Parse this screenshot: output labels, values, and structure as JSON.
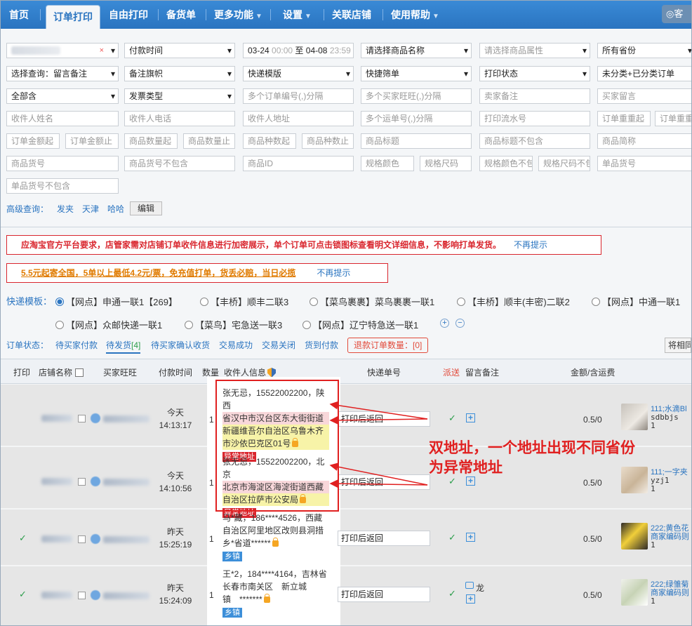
{
  "nav": {
    "items": [
      "首页",
      "订单打印",
      "自由打印",
      "备货单",
      "更多功能",
      "设置",
      "关联店铺",
      "使用帮助"
    ],
    "right": "客"
  },
  "filters": {
    "pay_time": "付款时间",
    "date_start": "03-24",
    "time_start": "00:00",
    "date_sep": "至",
    "date_end": "04-08",
    "time_end": "23:59",
    "product_name": "请选择商品名称",
    "product_attr": "请选择商品属性",
    "province": "所有省份",
    "query": "选择查询：留言备注",
    "memo_flag": "备注旗帜",
    "express_tpl": "快递模版",
    "quick_filter": "快捷筛单",
    "print_status": "打印状态",
    "category": "未分类+已分类订单",
    "all": "全部含",
    "invoice": "发票类型",
    "order_nos": "多个订单编号(,)分隔",
    "buyer_ww": "多个买家旺旺(,)分隔",
    "seller_memo": "卖家备注",
    "buyer_msg": "买家留言",
    "recv_name": "收件人姓名",
    "recv_phone": "收件人电话",
    "recv_addr": "收件人地址",
    "waybill_nos": "多个运单号(,)分隔",
    "print_serial": "打印流水号",
    "weight_from": "订单重重起",
    "weight_to": "订单重重",
    "amt_from": "订单金额起",
    "amt_to": "订单金额止",
    "qty_from": "商品数量起",
    "qty_to": "商品数量止",
    "kind_from": "商品种数起",
    "kind_to": "商品种数止",
    "title": "商品标题",
    "title_ex": "商品标题不包含",
    "short_name": "商品简称",
    "sku_no": "商品货号",
    "sku_no_ex": "商品货号不包含",
    "product_id": "商品ID",
    "spec_color": "规格颜色",
    "spec_size": "规格尺码",
    "spec_color_ex": "规格颜色不包",
    "spec_size_ex": "规格尺码不包",
    "single_no": "单品货号",
    "single_no_ex": "单品货号不包含",
    "adv_label": "高级查询：",
    "adv_links": [
      "发夹",
      "天津",
      "哈哈"
    ],
    "edit": "编辑"
  },
  "notices": {
    "n1": "应淘宝官方平台要求，店管家需对店铺订单收件信息进行加密展示，单个订单可点击锁图标查看明文详细信息，不影响打单发货。",
    "n1_link": "不再提示",
    "n2": "5.5元起寄全国，5单以上最低4.2元/票，免充值打单，货丢必赔，当日必揽",
    "n2_link": "不再提示"
  },
  "express": {
    "label": "快递模板：",
    "options": [
      "【网点】申通一联1【269】",
      "【丰桥】顺丰二联3",
      "【菜鸟裹裹】菜鸟裹裹一联1",
      "【丰桥】顺丰(丰密)二联2",
      "【网点】中通一联1",
      "【网点】众邮快递一联1",
      "【菜鸟】宅急送一联3",
      "【网点】辽宁特急送一联1"
    ]
  },
  "status": {
    "label": "订单状态：",
    "tabs": [
      "待买家付款",
      "待发货",
      "待买家确认收货",
      "交易成功",
      "交易关闭",
      "货到付款"
    ],
    "pending_count": "[4]",
    "refund": "退款订单数量：[0]",
    "right_btn": "将相同"
  },
  "table": {
    "headers": [
      "打印",
      "店铺名称",
      "买家旺旺",
      "付款时间",
      "数量",
      "收件人信息",
      "快递单号",
      "派送",
      "留言备注",
      "金额/含运费"
    ],
    "rows": [
      {
        "day": "今天",
        "time": "14:13:17",
        "qty": "1",
        "addr_a": "张无忌，15522002200，陕西",
        "addr_b": "省汉中市汉台区东大街街道",
        "addr_c": "新疆维吾尔自治区乌鲁木齐市沙依巴克区01号",
        "tag": "异常地址",
        "express": "打印后返回",
        "tick": "✓",
        "amount": "0.5/0",
        "p1": "111;水滴Bl",
        "p2": "sdbbjs",
        "p3": "1"
      },
      {
        "day": "今天",
        "time": "14:10:56",
        "qty": "1",
        "addr_a": "张无忌，15522002200，北京",
        "addr_b": "北京市海淀区海淀街道西藏",
        "addr_c": "自治区拉萨市公安局",
        "tag": "异常地址",
        "express": "打印后返回",
        "tick": "✓",
        "amount": "0.5/0",
        "p1": "111;一字夹",
        "p2": "yzj1",
        "p3": "1"
      },
      {
        "day": "昨天",
        "time": "15:25:19",
        "qty": "1",
        "addr_a": "马*藏，186****4526，西藏",
        "addr_b": "自治区阿里地区改则县洞措",
        "addr_c": "乡*省道******",
        "tag": "乡镇",
        "express": "打印后返回",
        "tick": "✓",
        "amount": "0.5/0",
        "printed": "✓",
        "p1": "222;黄色花",
        "p2": "商家编码则",
        "p3": "1"
      },
      {
        "day": "昨天",
        "time": "15:24:09",
        "qty": "1",
        "addr_a": "王*2，184****4164，吉林省",
        "addr_b": "长春市南关区　新立城",
        "addr_c": "镇　*******",
        "tag": "乡镇",
        "express": "打印后返回",
        "tick": "✓",
        "amount": "0.5/0",
        "printed": "✓",
        "memo": "龙",
        "p1": "222;绿雏菊",
        "p2": "商家编码则",
        "p3": "1"
      }
    ]
  },
  "annotation": {
    "line1": "双地址，一个地址出现不同省份",
    "line2": "为异常地址"
  },
  "colors": {
    "nav": "#2a74c0",
    "alert": "#d9262e",
    "orange_text": "#e07b00",
    "annotation": "#e02020"
  }
}
